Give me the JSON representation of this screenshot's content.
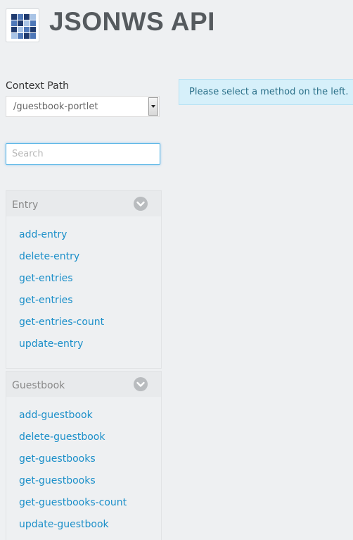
{
  "header": {
    "title": "JSONWS API"
  },
  "context": {
    "label": "Context Path",
    "selected": "/guestbook-portlet"
  },
  "search": {
    "placeholder": "Search"
  },
  "alert": {
    "message": "Please select a method on the left."
  },
  "panels": [
    {
      "title": "Entry",
      "methods": [
        "add-entry",
        "delete-entry",
        "get-entries",
        "get-entries",
        "get-entries-count",
        "update-entry"
      ]
    },
    {
      "title": "Guestbook",
      "methods": [
        "add-guestbook",
        "delete-guestbook",
        "get-guestbooks",
        "get-guestbooks",
        "get-guestbooks-count",
        "update-guestbook"
      ]
    }
  ],
  "colors": {
    "link": "#1b8fc9",
    "alert_bg": "#d6f0fa",
    "logo_dark": "#1f3a6e",
    "logo_mid": "#4f78b8",
    "logo_light": "#a9c4e6"
  },
  "icons": {
    "logo": "liferay-logo-icon",
    "panel_toggle": "chevron-down-circle-icon",
    "select_arrow": "caret-down-icon"
  }
}
